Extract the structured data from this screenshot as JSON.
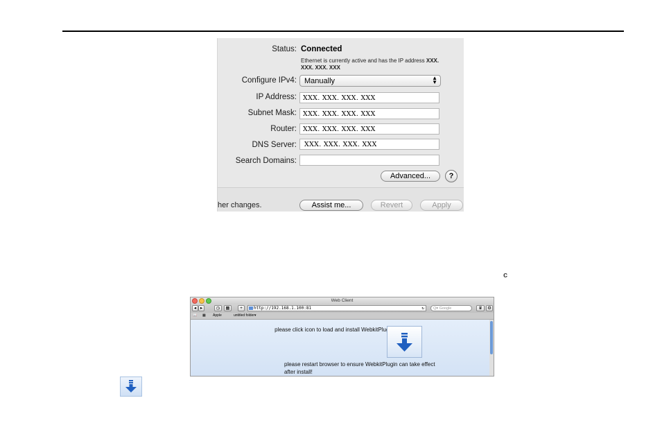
{
  "network_panel": {
    "status_label": "Status:",
    "status_value": "Connected",
    "status_desc_prefix": "Ethernet is currently active and has the IP address",
    "status_desc_ip": "XXX. XXX. XXX. XXX",
    "configure_label": "Configure IPv4:",
    "configure_value": "Manually",
    "ip_label": "IP Address:",
    "ip_value": "XXX. XXX. XXX. XXX",
    "subnet_label": "Subnet Mask:",
    "subnet_value": "XXX. XXX. XXX. XXX",
    "router_label": "Router:",
    "router_value": "XXX. XXX. XXX. XXX",
    "dns_label": "DNS Server:",
    "dns_value": "XXX. XXX. XXX. XXX",
    "search_domains_label": "Search Domains:",
    "search_domains_value": "",
    "advanced_button": "Advanced...",
    "help_button": "?",
    "hint_text": "her changes.",
    "assist_button": "Assist me...",
    "revert_button": "Revert",
    "apply_button": "Apply"
  },
  "reload_glyph": "c",
  "browser": {
    "window_title": "Web Client",
    "url": "http://192.168.1.100:81",
    "search_placeholder": "Q▾ Google",
    "bookmarks": [
      "Apple",
      "untitled folder▾"
    ],
    "message_1": "please click icon to load and install WebkitPlugin:",
    "message_2": "please restart browser to ensure WebkitPlugin can take effect after install!"
  },
  "icons": {
    "download": "download-arrow-icon",
    "help": "question-icon"
  },
  "colors": {
    "download_arrow": "#1f5fc0",
    "browser_bg": "#dde9f7"
  }
}
